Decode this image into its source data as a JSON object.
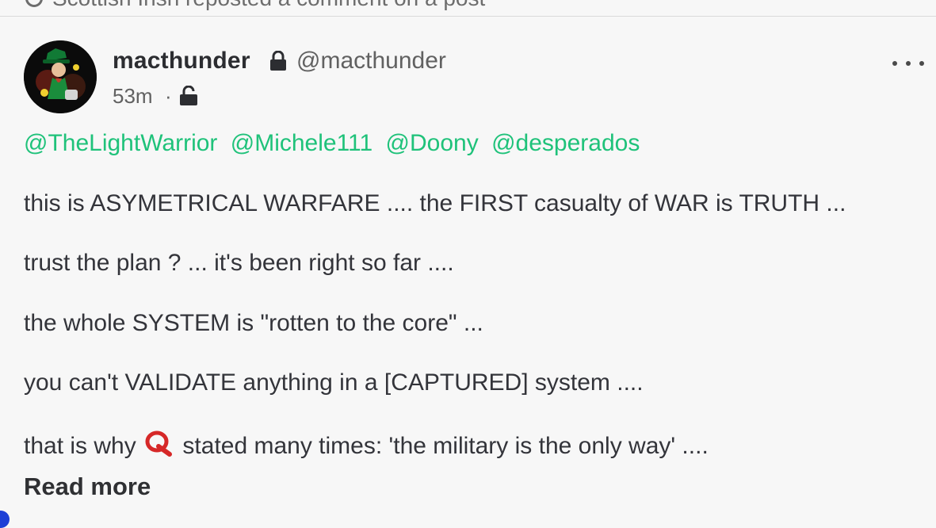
{
  "repost": {
    "text": "Scottish Irish reposted a comment on a post"
  },
  "author": {
    "display_name": "macthunder",
    "handle": "@macthunder",
    "time": "53m",
    "separator": "·"
  },
  "post": {
    "mentions": [
      "@TheLightWarrior",
      "@Michele111",
      "@Doony",
      "@desperados"
    ],
    "lines": [
      "this is ASYMETRICAL WARFARE .... the FIRST casualty of WAR is TRUTH ...",
      "trust the plan ? ... it's been right so far ....",
      "the whole SYSTEM is \"rotten to the core\" ...",
      "you can't VALIDATE anything in a [CAPTURED] system ...."
    ],
    "last_line_before": "that is why",
    "last_line_after": "stated many times: 'the military is the only way' ....",
    "read_more": "Read more"
  },
  "colors": {
    "mention": "#1fc27a",
    "q_icon": "#d62828",
    "text": "#33343a"
  },
  "icons": {
    "header_lock": "lock-icon",
    "visibility": "unlock-icon",
    "q": "q-icon",
    "menu": "more-icon"
  }
}
